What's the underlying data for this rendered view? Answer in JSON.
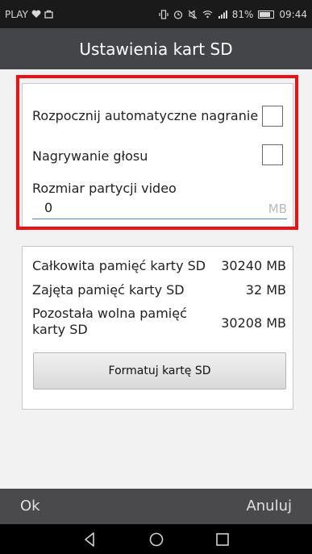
{
  "status_bar": {
    "carrier": "PLAY",
    "battery_percent": "81%",
    "battery_level": 0.81,
    "time": "09:44"
  },
  "title": "Ustawienia kart SD",
  "settings": {
    "auto_record_label": "Rozpocznij automatyczne nagranie",
    "auto_record_checked": false,
    "voice_record_label": "Nagrywanie głosu",
    "voice_record_checked": false,
    "partition_label": "Rozmiar partycji video",
    "partition_value": "0",
    "partition_unit": "MB"
  },
  "storage": {
    "total_label": "Całkowita pamięć karty SD",
    "total_value": "30240 MB",
    "used_label": "Zajęta pamięć karty SD",
    "used_value": "32 MB",
    "free_label": "Pozostała wolna pamięć karty SD",
    "free_value": "30208 MB",
    "format_button": "Formatuj kartę SD"
  },
  "footer": {
    "ok_label": "Ok",
    "cancel_label": "Anuluj"
  },
  "icons": {
    "heart": "heart-icon",
    "bag": "bag-icon",
    "vibrate": "vibrate-icon",
    "alarm": "alarm-icon",
    "mute": "mute-icon",
    "wifi": "wifi-icon",
    "signal": "signal-icon",
    "battery": "battery-icon",
    "back": "back-icon",
    "home": "home-icon",
    "recents": "recents-icon"
  },
  "colors": {
    "highlight": "#ee1111",
    "title_bar": "#444548",
    "input_underline": "#3f8fd6"
  }
}
